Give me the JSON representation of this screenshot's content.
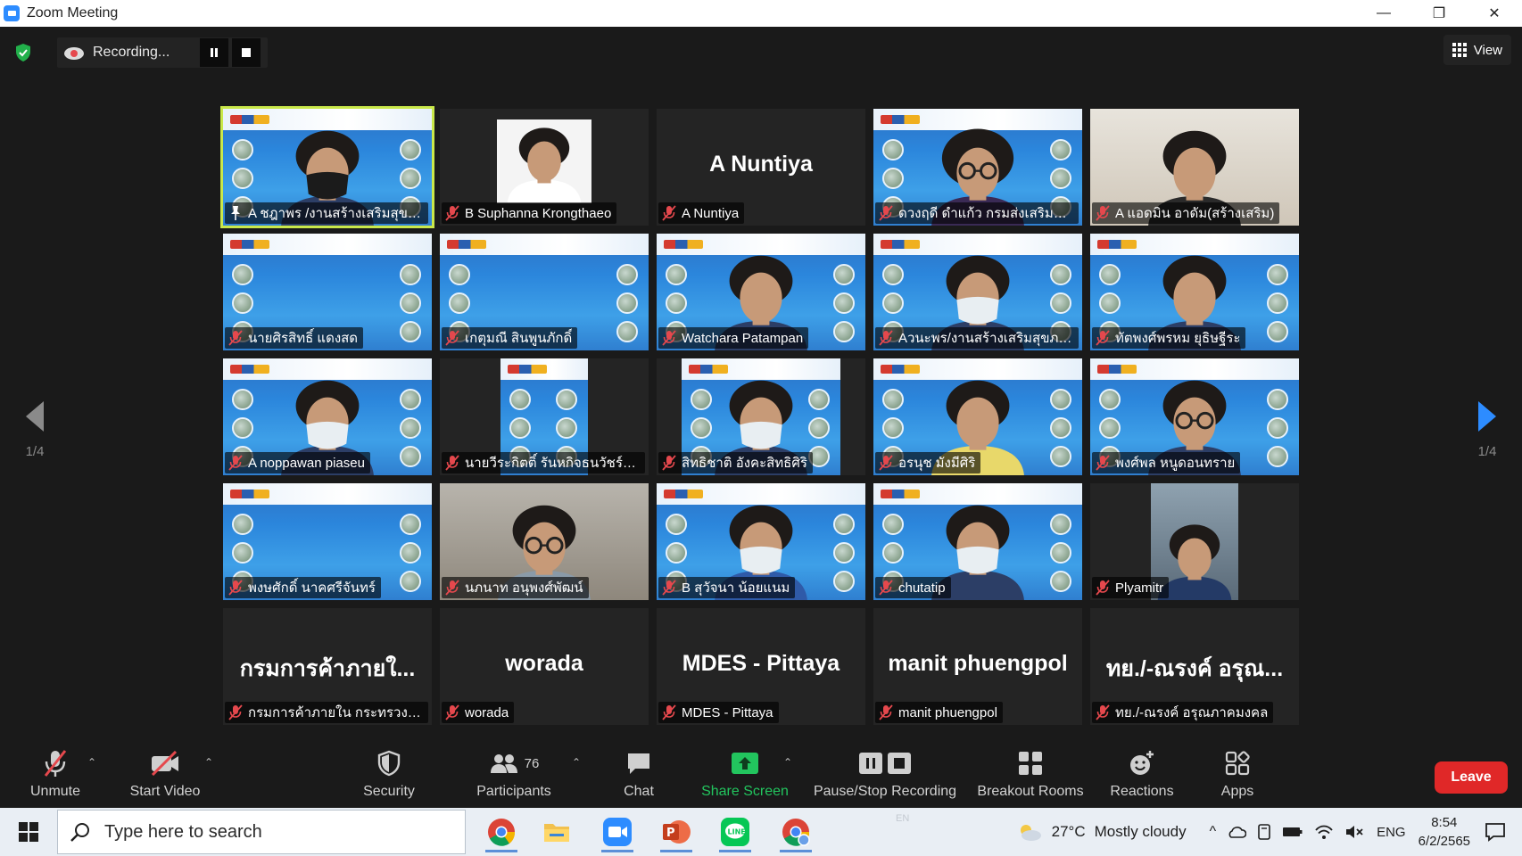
{
  "window": {
    "title": "Zoom Meeting",
    "minimize_glyph": "—",
    "restore_glyph": "❐",
    "close_glyph": "✕"
  },
  "meeting": {
    "recording_label": "Recording...",
    "view_label": "View",
    "page_left": "1/4",
    "page_right": "1/4"
  },
  "tiles": [
    {
      "name": "A ชฎาพร /งานสร้างเสริมสุขภ...",
      "bg": "event",
      "person": "mask-dark",
      "active": true,
      "pin": true
    },
    {
      "name": "B Suphanna Krongthaeo",
      "bg": "photo-white",
      "person": "doctor"
    },
    {
      "name": "A Nuntiya",
      "bg": "plain",
      "big": "A Nuntiya"
    },
    {
      "name": "ดวงฤดี ดำแก้ว กรมส่งเสริมกา...",
      "bg": "event",
      "person": "glasses-woman"
    },
    {
      "name": "A แอดมิน อาดัม(สร้างเสริม)",
      "bg": "room",
      "person": "man-close"
    },
    {
      "name": "นายศิรสิทธิ์ แดงสด",
      "bg": "event"
    },
    {
      "name": "เกตุมณี สินพูนภักดิ์",
      "bg": "event"
    },
    {
      "name": "Watchara Patampan",
      "bg": "event",
      "person": "man"
    },
    {
      "name": "Aวนะพร/งานสร้างเสริมสุขภาพ",
      "bg": "event",
      "person": "mask-woman"
    },
    {
      "name": "ทัตพงศ์พรหม ยุธิษฐีระ",
      "bg": "event",
      "person": "small-man"
    },
    {
      "name": "A noppawan piaseu",
      "bg": "event",
      "person": "mask-woman-light"
    },
    {
      "name": "นายวีระกิตติ์ รันหกิจธนวัชร์ ผู้...",
      "bg": "narrow-event"
    },
    {
      "name": "สิทธิชาติ อังคะสิทธิศิริ",
      "bg": "mid-event",
      "person": "mask-man"
    },
    {
      "name": "อรนุช มังมีศิริ",
      "bg": "event",
      "person": "yellow-woman"
    },
    {
      "name": "พงศ์พล หนูดอนทราย",
      "bg": "event",
      "person": "glasses-man"
    },
    {
      "name": "พงษศักดิ์ นาคศรีจันทร์",
      "bg": "event"
    },
    {
      "name": "นภนาท อนุพงศ์พัฒน์",
      "bg": "room-dark",
      "person": "glasses-man-wave"
    },
    {
      "name": "B สุวัจนา น้อยแนม",
      "bg": "event",
      "person": "mask-woman-blue"
    },
    {
      "name": "chutatip",
      "bg": "event",
      "person": "mask-youth"
    },
    {
      "name": "Plyamitr",
      "bg": "photo-suit",
      "person": "suit"
    },
    {
      "name": "กรมการค้าภายใน กระทรวงพา...",
      "bg": "plain",
      "big": "กรมการค้าภายใ..."
    },
    {
      "name": "worada",
      "bg": "plain",
      "big": "worada"
    },
    {
      "name": "MDES - Pittaya",
      "bg": "plain",
      "big": "MDES - Pittaya"
    },
    {
      "name": "manit phuengpol",
      "bg": "plain",
      "big": "manit phuengpol"
    },
    {
      "name": "ทย./-ณรงค์ อรุณภาคมงคล",
      "bg": "plain",
      "big": "ทย./-ณรงค์ อรุณ..."
    }
  ],
  "controls": {
    "unmute": "Unmute",
    "start_video": "Start Video",
    "security": "Security",
    "participants": "Participants",
    "participants_count": "76",
    "chat": "Chat",
    "share_screen": "Share Screen",
    "pause_stop": "Pause/Stop Recording",
    "breakout": "Breakout Rooms",
    "reactions": "Reactions",
    "apps": "Apps",
    "leave": "Leave"
  },
  "taskbar": {
    "search_placeholder": "Type here to search",
    "ime_hint": "EN",
    "temperature": "27°C",
    "weather": "Mostly cloudy",
    "language": "ENG",
    "time": "8:54",
    "date": "6/2/2565"
  },
  "colors": {
    "accent_active": "#c9e84a",
    "share_green": "#22c55e",
    "leave_red": "#e02828",
    "muted_red": "#e5484d"
  }
}
